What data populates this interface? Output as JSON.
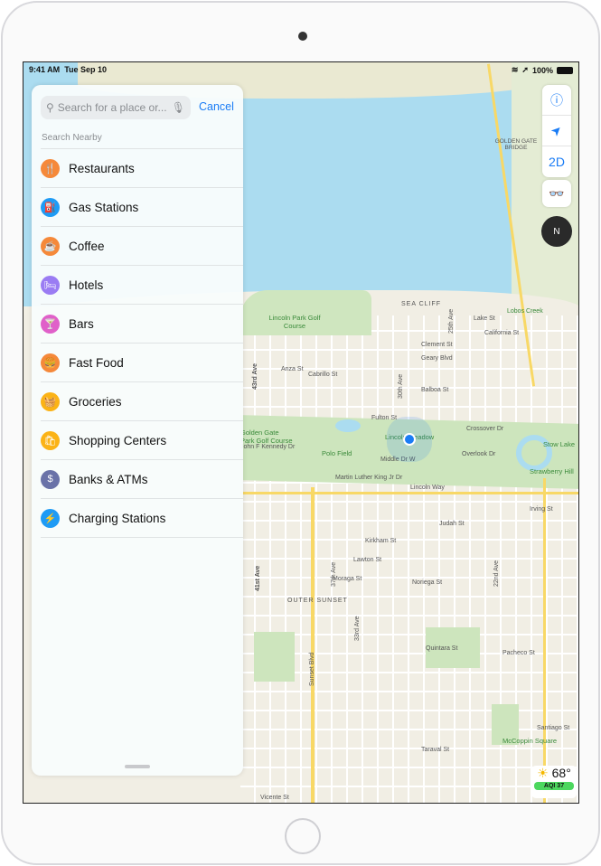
{
  "status_bar": {
    "time": "9:41 AM",
    "date": "Tue Sep 10",
    "battery": "100%"
  },
  "search": {
    "placeholder": "Search for a place or...",
    "cancel_label": "Cancel",
    "section_title": "Search Nearby"
  },
  "categories": [
    {
      "label": "Restaurants",
      "icon": "fork-knife-icon",
      "color": "#f5893a",
      "glyph": "🍴"
    },
    {
      "label": "Gas Stations",
      "icon": "fuel-pump-icon",
      "color": "#1e9bf5",
      "glyph": "⛽"
    },
    {
      "label": "Coffee",
      "icon": "coffee-cup-icon",
      "color": "#f5893a",
      "glyph": "☕"
    },
    {
      "label": "Hotels",
      "icon": "bed-icon",
      "color": "#9a7cf3",
      "glyph": "🛏"
    },
    {
      "label": "Bars",
      "icon": "cocktail-icon",
      "color": "#e060c9",
      "glyph": "🍸"
    },
    {
      "label": "Fast Food",
      "icon": "burger-drink-icon",
      "color": "#f5893a",
      "glyph": "🍔"
    },
    {
      "label": "Groceries",
      "icon": "basket-icon",
      "color": "#fbb316",
      "glyph": "🧺"
    },
    {
      "label": "Shopping Centers",
      "icon": "shopping-bag-icon",
      "color": "#fbb316",
      "glyph": "🛍"
    },
    {
      "label": "Banks & ATMs",
      "icon": "bank-icon",
      "color": "#6a72a8",
      "glyph": "$"
    },
    {
      "label": "Charging Stations",
      "icon": "ev-plug-icon",
      "color": "#1e9bf5",
      "glyph": "⚡"
    }
  ],
  "map_controls": {
    "info": "ⓘ",
    "location": "➤",
    "view_mode": "2D",
    "binoculars": "👓",
    "compass": "N"
  },
  "weather": {
    "temperature": "68°",
    "aqi": "AQI 37"
  },
  "map_labels": {
    "golden_gate": "GOLDEN GATE BRIDGE",
    "sea_cliff": "SEA CLIFF",
    "lincoln_park": "Lincoln Park Golf Course",
    "lobos": "Lobos Creek",
    "lake_st": "Lake St",
    "california": "California St",
    "clement": "Clement St",
    "geary": "Geary Blvd",
    "anza": "Anza St",
    "balboa": "Balboa St",
    "cabrillo": "Cabrillo St",
    "fulton": "Fulton St",
    "crossover": "Crossover Dr",
    "meadow": "Lincoln Meadow",
    "polo": "Polo Field",
    "golden_gate_park": "Golden Gate Park Golf Course",
    "jfk": "John F Kennedy Dr",
    "middle": "Middle Dr W",
    "overlook": "Overlook Dr",
    "stow": "Stow Lake",
    "strawberry": "Strawberry Hill",
    "mlk": "Martin Luther King Jr Dr",
    "lincoln_way": "Lincoln Way",
    "irving": "Irving St",
    "judah": "Judah St",
    "kirkham": "Kirkham St",
    "lawton": "Lawton St",
    "moraga": "Moraga St",
    "noriega": "Noriega St",
    "outer_sunset": "OUTER SUNSET",
    "quintara": "Quintara St",
    "pacheco": "Pacheco St",
    "santiago": "Santiago St",
    "taraval": "Taraval St",
    "vicente": "Vicente St",
    "sunset_blvd": "Sunset Blvd",
    "mccoppin": "McCoppin Square",
    "ave41": "41st Ave",
    "ave43": "43rd Ave",
    "ave30": "30th Ave",
    "ave25": "25th Ave",
    "ave37": "37th Ave",
    "ave33": "33rd Ave",
    "ave22": "22nd Ave"
  }
}
